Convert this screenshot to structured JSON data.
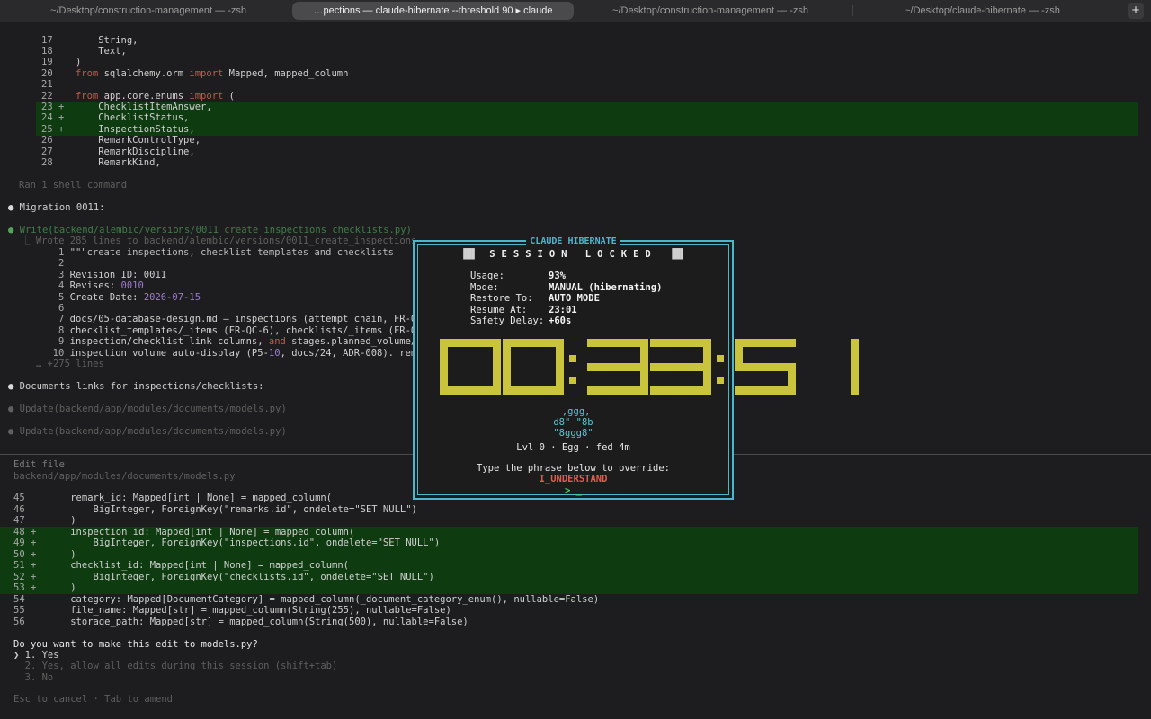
{
  "tabs": [
    {
      "label": "~/Desktop/construction-management — -zsh",
      "active": false
    },
    {
      "label": "…pections — claude-hibernate --threshold 90 ▸ claude",
      "active": true
    },
    {
      "label": "~/Desktop/construction-management — -zsh",
      "active": false
    },
    {
      "label": "~/Desktop/claude-hibernate — -zsh",
      "active": false
    }
  ],
  "new_tab_label": "+",
  "top_code": [
    {
      "n": "17",
      "t": "    String,"
    },
    {
      "n": "18",
      "t": "    Text,"
    },
    {
      "n": "19",
      "t": ")"
    },
    {
      "n": "20",
      "k1": "from",
      "m1": " sqlalchemy.orm ",
      "k2": "import",
      "m2": " Mapped, mapped_column"
    },
    {
      "n": "21",
      "t": ""
    },
    {
      "n": "22",
      "k1": "from",
      "m1": " app.core.enums ",
      "k2": "import",
      "m2": " ("
    },
    {
      "n": "23 +",
      "t": "    ChecklistItemAnswer,"
    },
    {
      "n": "24 +",
      "t": "    ChecklistStatus,"
    },
    {
      "n": "25 +",
      "t": "    InspectionStatus,"
    },
    {
      "n": "26",
      "t": "    RemarkControlType,"
    },
    {
      "n": "27",
      "t": "    RemarkDiscipline,"
    },
    {
      "n": "28",
      "t": "    RemarkKind,"
    }
  ],
  "ran_shell": "Ran 1 shell command",
  "migration_heading": "Migration 0011:",
  "write_call": "Write(backend/alembic/versions/0011_create_inspections_checklists.py)",
  "write_result": "⎿ Wrote 285 lines to backend/alembic/versions/0011_create_inspections_",
  "write_lines": [
    {
      "n": "1",
      "t": "\"\"\"create inspections, checklist templates and checklists"
    },
    {
      "n": "2",
      "t": ""
    },
    {
      "n": "3",
      "t": "Revision ID: 0011"
    },
    {
      "n": "4",
      "a": "Revises: ",
      "p": "0010"
    },
    {
      "n": "5",
      "a": "Create Date: ",
      "p": "2026-07-15"
    },
    {
      "n": "6",
      "t": ""
    },
    {
      "n": "7",
      "t": "docs/05-database-design.md — inspections (attempt chain, FR-QC-"
    },
    {
      "n": "8",
      "t": "checklist_templates/_items (FR-QC-6), checklists/_items (FR-QC-"
    },
    {
      "n": "9",
      "a": "inspection/checklist link columns, ",
      "k": "and",
      "b": " stages.planned_volume/un"
    },
    {
      "n": "10",
      "a": "inspection volume auto-display (P5-",
      "p": "10",
      "b": ", docs/24, ADR-008). remar"
    }
  ],
  "more_lines": "… +275 lines",
  "docs_heading": "Documents links for inspections/checklists:",
  "update_calls": [
    "Update(backend/app/modules/documents/models.py)",
    "Update(backend/app/modules/documents/models.py)"
  ],
  "edit_title": "Edit file",
  "edit_path": "backend/app/modules/documents/models.py",
  "diff": [
    {
      "n": "45",
      "add": false,
      "t": "    remark_id: Mapped[int | None] = mapped_column("
    },
    {
      "n": "46",
      "add": false,
      "t": "        BigInteger, ForeignKey(\"remarks.id\", ondelete=\"SET NULL\")"
    },
    {
      "n": "47",
      "add": false,
      "t": "    )"
    },
    {
      "n": "48 +",
      "add": true,
      "t": "    inspection_id: Mapped[int | None] = mapped_column("
    },
    {
      "n": "49 +",
      "add": true,
      "t": "        BigInteger, ForeignKey(\"inspections.id\", ondelete=\"SET NULL\")"
    },
    {
      "n": "50 +",
      "add": true,
      "t": "    )"
    },
    {
      "n": "51 +",
      "add": true,
      "t": "    checklist_id: Mapped[int | None] = mapped_column("
    },
    {
      "n": "52 +",
      "add": true,
      "t": "        BigInteger, ForeignKey(\"checklists.id\", ondelete=\"SET NULL\")"
    },
    {
      "n": "53 +",
      "add": true,
      "t": "    )"
    },
    {
      "n": "54",
      "add": false,
      "t": "    category: Mapped[DocumentCategory] = mapped_column(_document_category_enum(), nullable=False)"
    },
    {
      "n": "55",
      "add": false,
      "t": "    file_name: Mapped[str] = mapped_column(String(255), nullable=False)"
    },
    {
      "n": "56",
      "add": false,
      "t": "    storage_path: Mapped[str] = mapped_column(String(500), nullable=False)"
    }
  ],
  "question": "Do you want to make this edit to models.py?",
  "options": [
    {
      "label": "❯ 1. Yes",
      "selected": true
    },
    {
      "label": "  2. Yes, allow all edits during this session (shift+tab)",
      "selected": false
    },
    {
      "label": "  3. No",
      "selected": false
    }
  ],
  "footer_hint": "Esc to cancel · Tab to amend",
  "modal": {
    "title": "CLAUDE HIBERNATE",
    "block_left": "▐█▌",
    "locked": "SESSION LOCKED",
    "block_right": "▐█▌",
    "fields": [
      {
        "key": "Usage:",
        "value": "93%"
      },
      {
        "key": "Mode:",
        "value": "MANUAL (hibernating)"
      },
      {
        "key": "Restore To:",
        "value": "AUTO MODE"
      },
      {
        "key": "Resume At:",
        "value": "23:01"
      },
      {
        "key": "Safety Delay:",
        "value": "+60s"
      }
    ],
    "countdown": "00:33:51",
    "pet_art": [
      " ,ggg,",
      "d8\" \"8b",
      "\"8ggg8\""
    ],
    "pet_status": "Lvl 0 · Egg · fed 4m",
    "override_prompt": "Type the phrase below to override:",
    "override_phrase": "I_UNDERSTAND",
    "input_prompt": "> _"
  },
  "colors": {
    "background": "#1d1d1f",
    "modal_border": "#4ab8cc",
    "countdown": "#c9c43b",
    "diff_add_bg": "#0e3b10",
    "phrase": "#e35b4c"
  }
}
